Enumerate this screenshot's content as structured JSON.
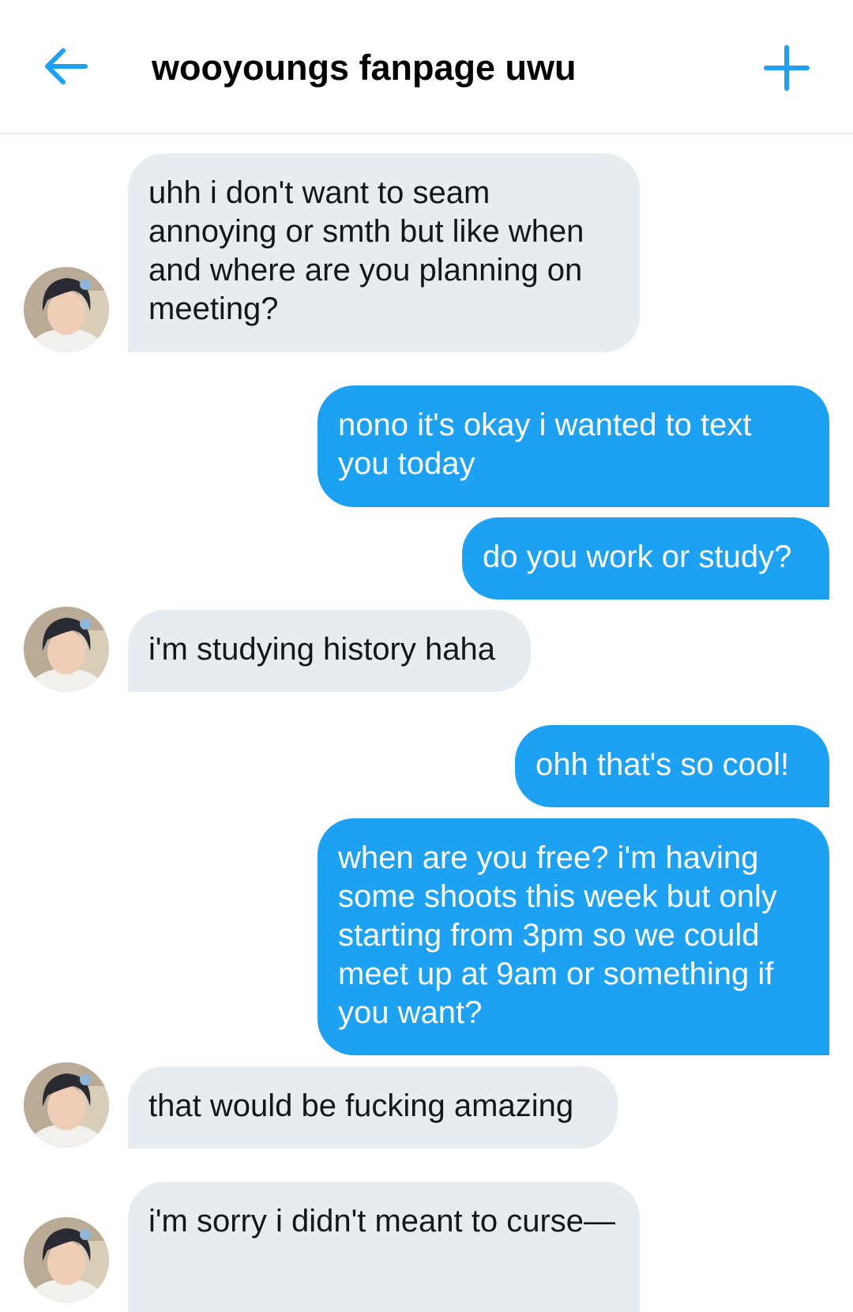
{
  "header": {
    "title": "wooyoungs fanpage uwu",
    "back_icon": "arrow-left-icon",
    "add_icon": "plus-icon",
    "accent_color": "#1da1f2"
  },
  "colors": {
    "incoming_bubble": "#e6ecf0",
    "outgoing_bubble": "#1da1f2"
  },
  "messages": [
    {
      "direction": "in",
      "text": "uhh i don't want to seam annoying or smth but like when and where are you planning on meeting?"
    },
    {
      "direction": "out",
      "text": "nono it's okay i wanted to text you today"
    },
    {
      "direction": "out",
      "text": "do you work or study?"
    },
    {
      "direction": "in",
      "text": "i'm studying history haha"
    },
    {
      "direction": "out",
      "text": "ohh that's so cool!"
    },
    {
      "direction": "out",
      "text": "when are you free? i'm having some shoots this week but only starting from 3pm so we could meet up at 9am or something if you want?"
    },
    {
      "direction": "in",
      "text": "that would be fucking amazing"
    },
    {
      "direction": "in",
      "text": "i'm sorry i didn't meant to curse—"
    }
  ]
}
